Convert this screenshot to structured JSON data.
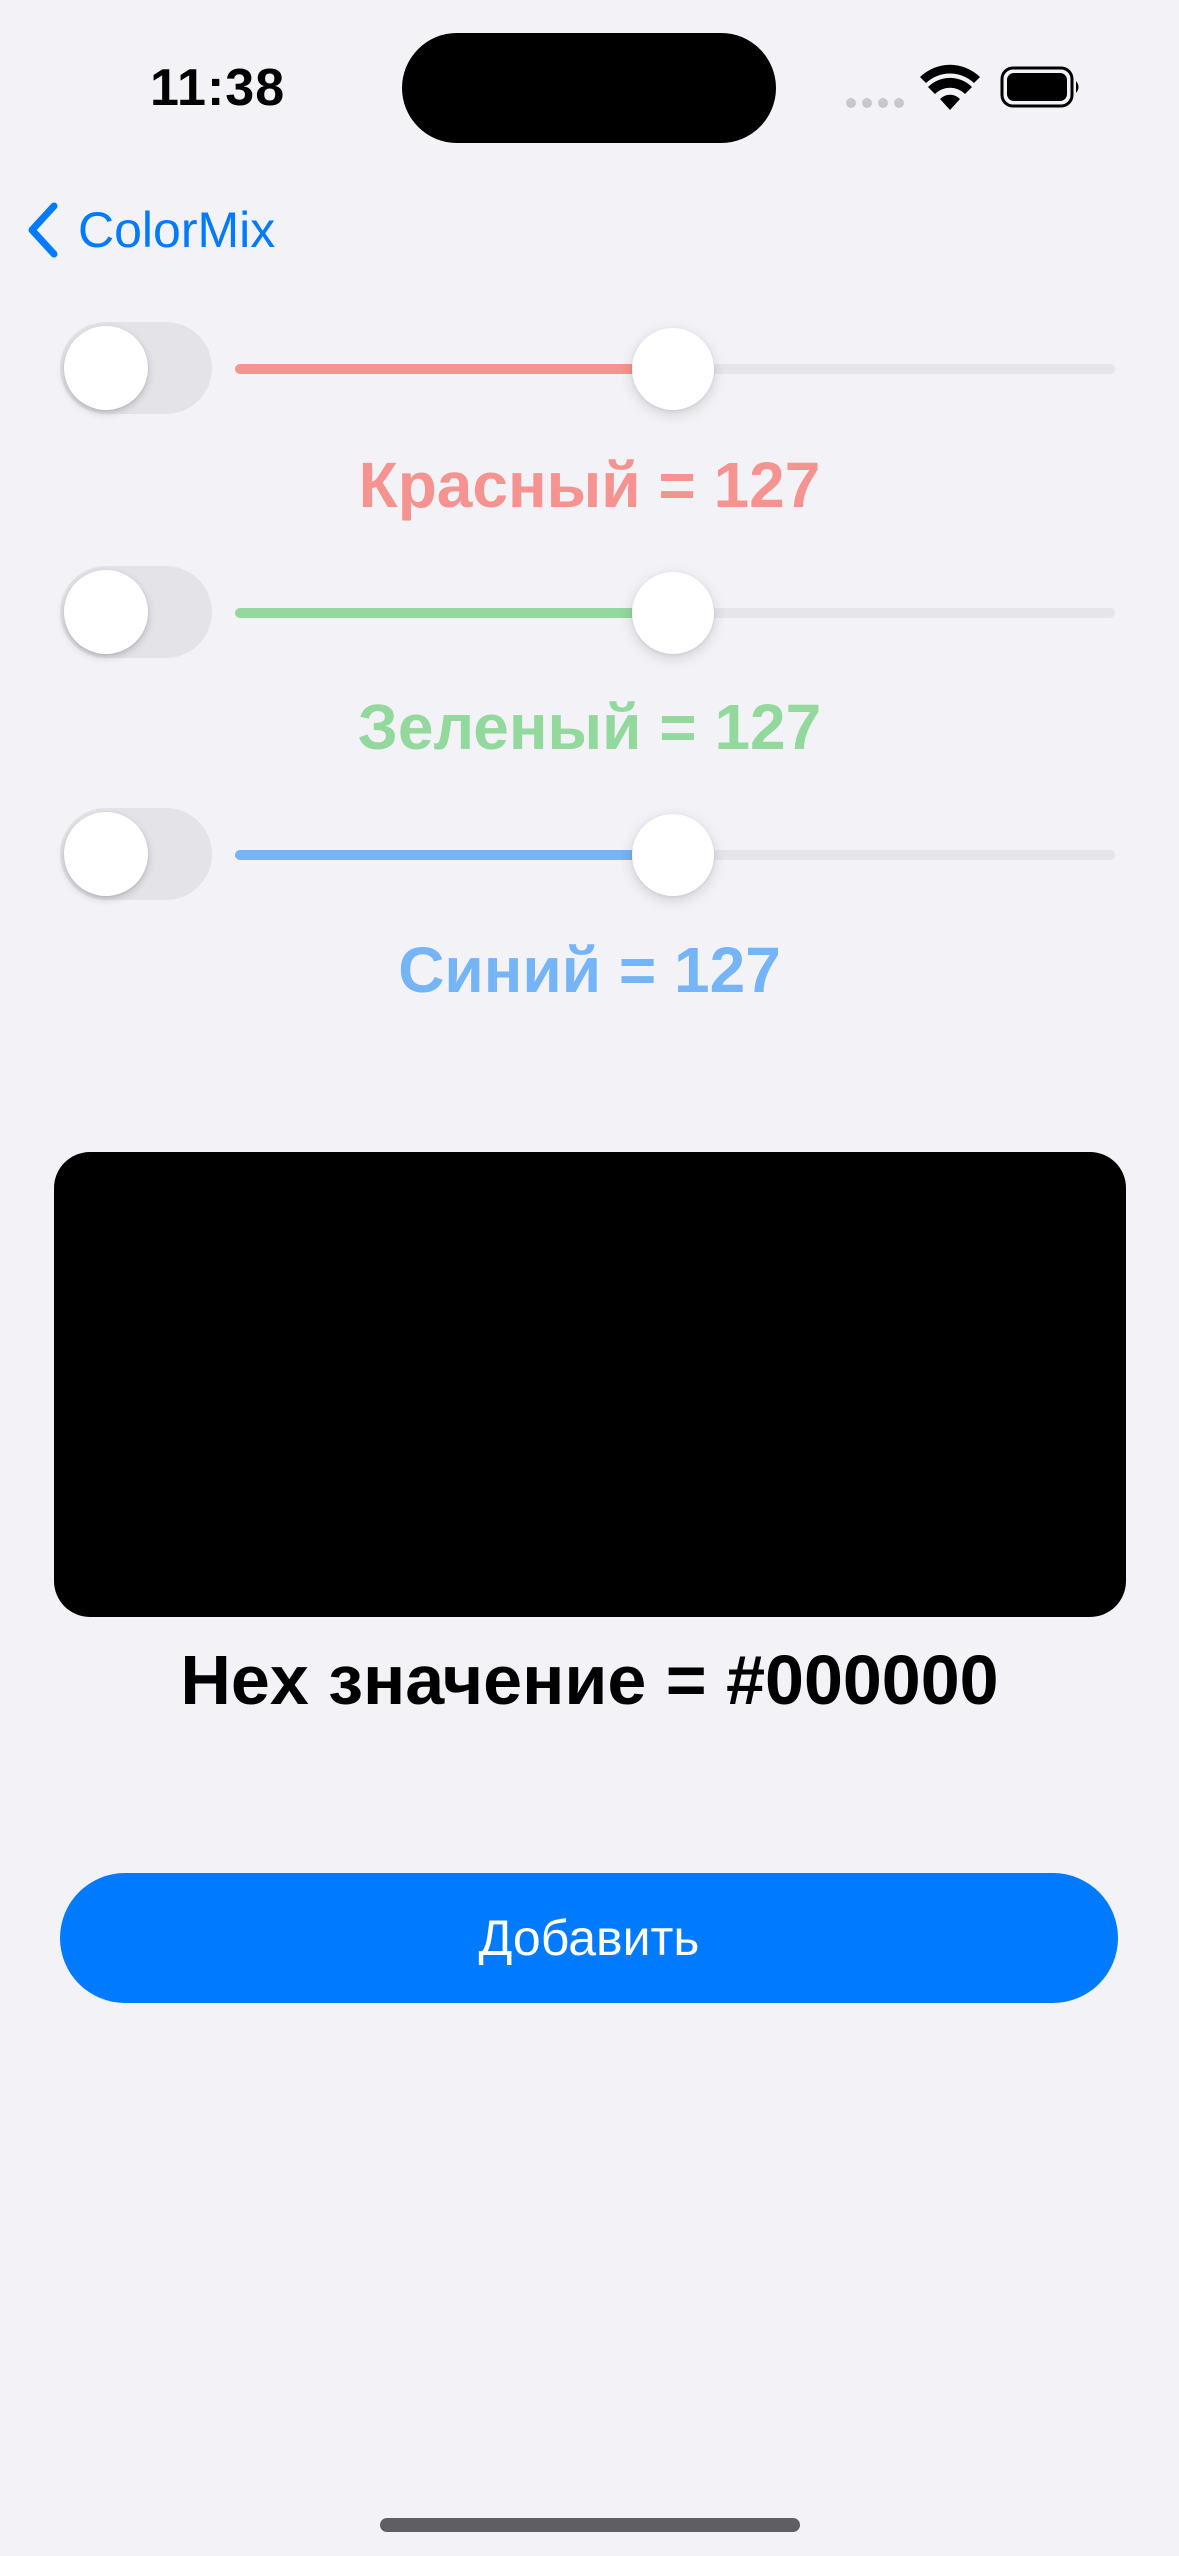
{
  "status_bar": {
    "time": "11:38"
  },
  "nav": {
    "back_label": "ColorMix"
  },
  "sliders": [
    {
      "name": "red",
      "label": "Красный = 127",
      "value": 127,
      "min": 0,
      "max": 255,
      "toggle_on": false,
      "color": "#f4938f"
    },
    {
      "name": "green",
      "label": "Зеленый = 127",
      "value": 127,
      "min": 0,
      "max": 255,
      "toggle_on": false,
      "color": "#93d89d"
    },
    {
      "name": "blue",
      "label": "Синий = 127",
      "value": 127,
      "min": 0,
      "max": 255,
      "toggle_on": false,
      "color": "#74b4f7"
    }
  ],
  "preview": {
    "color": "#000000"
  },
  "hex": {
    "label": "Hex значение = #000000"
  },
  "add_button": {
    "label": "Добавить"
  },
  "colors": {
    "accent": "#007aff",
    "background": "#f2f2f7"
  }
}
